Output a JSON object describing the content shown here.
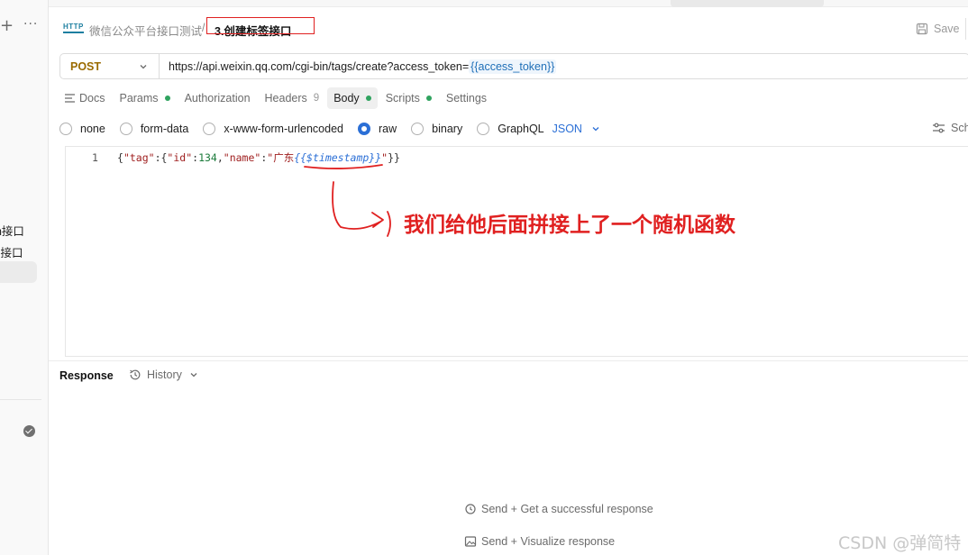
{
  "sidebar": {
    "plus_label": "+",
    "more_label": "···",
    "items": [
      {
        "label": "en接口"
      },
      {
        "label": "签接口"
      }
    ]
  },
  "header": {
    "breadcrumb_parent": "微信公众平台接口测试",
    "breadcrumb_separator": "/",
    "breadcrumb_current": "3.创建标签接口",
    "save_label": "Save"
  },
  "request": {
    "method": "POST",
    "url_base": "https://api.weixin.qq.com/cgi-bin/tags/create?access_token=",
    "url_variable": "{{access_token}}"
  },
  "tabs": [
    {
      "label": "Docs"
    },
    {
      "label": "Params"
    },
    {
      "label": "Authorization"
    },
    {
      "label": "Headers",
      "count": "9"
    },
    {
      "label": "Body"
    },
    {
      "label": "Scripts"
    },
    {
      "label": "Settings"
    }
  ],
  "body_types": {
    "options": [
      "none",
      "form-data",
      "x-www-form-urlencoded",
      "raw",
      "binary",
      "GraphQL"
    ],
    "selected": "raw",
    "format": "JSON",
    "schema_label": "Sch"
  },
  "editor": {
    "line_number": "1",
    "code": {
      "p1": "{",
      "k1": "\"tag\"",
      "p2": ":{",
      "k2": "\"id\"",
      "p3": ":",
      "n1": "134",
      "p4": ",",
      "k3": "\"name\"",
      "p5": ":",
      "s1": "\"广东",
      "v1": "{{$timestamp}}",
      "s2": "\"",
      "p6": "}}"
    }
  },
  "annotation": {
    "text": "我们给他后面拼接上了一个随机函数",
    "color": "#e02020"
  },
  "response": {
    "title": "Response",
    "history_label": "History",
    "hint_success": "Send + Get a successful response",
    "hint_visualize": "Send + Visualize response"
  },
  "watermark": "CSDN @弹简特",
  "colors": {
    "accent_blue": "#2b6fd6",
    "method_post": "#9a6a00",
    "status_green": "#2fa35f"
  }
}
